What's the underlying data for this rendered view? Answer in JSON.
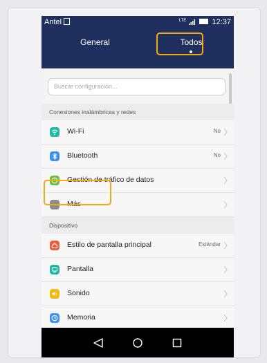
{
  "status": {
    "carrier": "Antel",
    "network": "LTE",
    "time": "12:37"
  },
  "tabs": [
    {
      "label": "General"
    },
    {
      "label": "Todos"
    }
  ],
  "search": {
    "placeholder": "Buscar configuración..."
  },
  "sections": [
    {
      "title": "Conexiones inalámbricas y redes",
      "items": [
        {
          "label": "Wi-Fi",
          "value": "No",
          "icon": "wifi-icon",
          "color": "#1fb9a3"
        },
        {
          "label": "Bluetooth",
          "value": "No",
          "icon": "bluetooth-icon",
          "color": "#3a8ff1"
        },
        {
          "label": "Gestión de tráfico de datos",
          "value": "",
          "icon": "data-traffic-icon",
          "color": "#6bbf3c"
        },
        {
          "label": "Más",
          "value": "",
          "icon": "more-icon",
          "color": "#8c8c8c"
        }
      ]
    },
    {
      "title": "Dispositivo",
      "items": [
        {
          "label": "Estilo de pantalla principal",
          "value": "Estándar",
          "icon": "home-style-icon",
          "color": "#f05c3a"
        },
        {
          "label": "Pantalla",
          "value": "",
          "icon": "display-icon",
          "color": "#1fb9a3"
        },
        {
          "label": "Sonido",
          "value": "",
          "icon": "sound-icon",
          "color": "#f2b90f"
        },
        {
          "label": "Memoria",
          "value": "",
          "icon": "memory-icon",
          "color": "#3a8ff1"
        }
      ]
    }
  ],
  "colors": {
    "header": "#1f2f5e",
    "highlight": "#f4a90e"
  }
}
